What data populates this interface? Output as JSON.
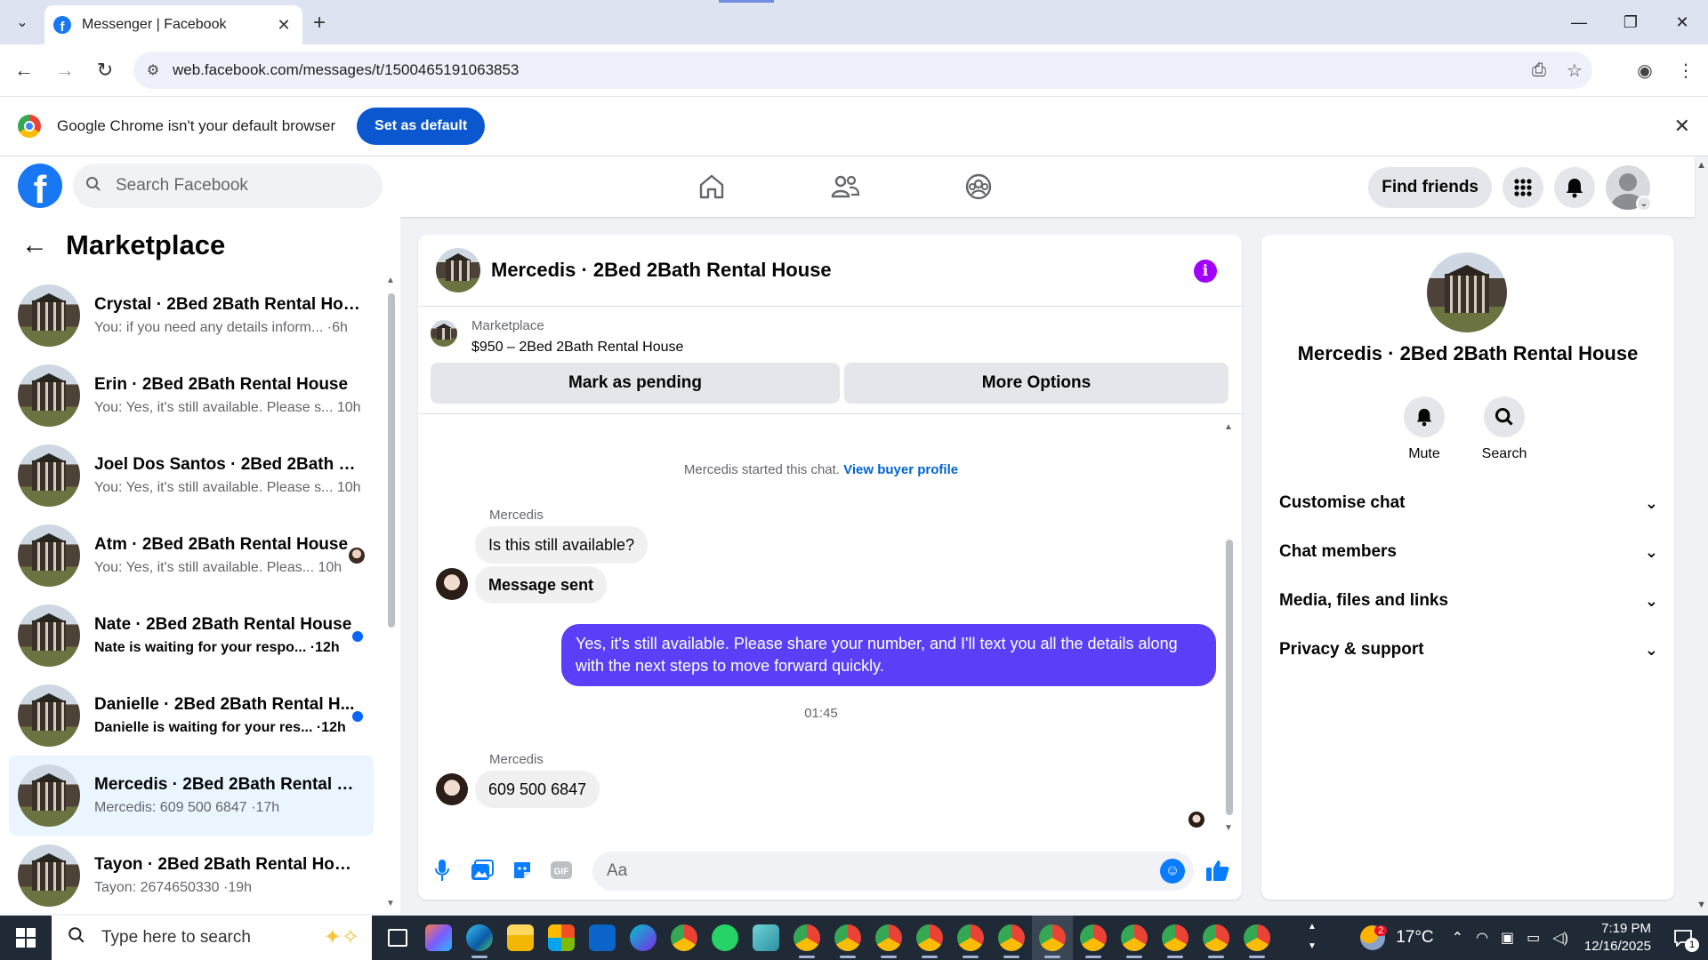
{
  "browser": {
    "tab_title": "Messenger | Facebook",
    "url": "web.facebook.com/messages/t/1500465191063853",
    "infobar_message": "Google Chrome isn't your default browser",
    "infobar_button": "Set as default"
  },
  "header": {
    "search_placeholder": "Search Facebook",
    "find_friends": "Find friends"
  },
  "left": {
    "title": "Marketplace",
    "conversations": [
      {
        "name": "Crystal · 2Bed 2Bath Rental House",
        "preview": "You: if you need any details inform... ·6h",
        "unread": false
      },
      {
        "name": "Erin · 2Bed 2Bath Rental House",
        "preview": "You: Yes, it's still available. Please s... 10h",
        "unread": false
      },
      {
        "name": "Joel Dos Santos · 2Bed 2Bath Re...",
        "preview": "You: Yes, it's still available. Please s... 10h",
        "unread": false
      },
      {
        "name": "Atm · 2Bed 2Bath Rental House",
        "preview": "You: Yes, it's still available. Pleas... 10h",
        "unread": false
      },
      {
        "name": "Nate · 2Bed 2Bath Rental House",
        "preview": "Nate is waiting for your respo... ·12h",
        "unread": true
      },
      {
        "name": "Danielle · 2Bed 2Bath Rental H...",
        "preview": "Danielle is waiting for your res... ·12h",
        "unread": true
      },
      {
        "name": "Mercedis · 2Bed 2Bath Rental H...",
        "preview": "Mercedis: 609 500 6847 ·17h",
        "unread": false
      },
      {
        "name": "Tayon · 2Bed 2Bath Rental House",
        "preview": "Tayon: 2674650330 ·19h",
        "unread": false
      }
    ]
  },
  "chat": {
    "title": "Mercedis · 2Bed 2Bath Rental House",
    "listing_label": "Marketplace",
    "listing_price": "$950 – 2Bed 2Bath Rental House",
    "mark_pending": "Mark as pending",
    "more_options": "More Options",
    "system_text": "Mercedis started this chat.",
    "system_link": "View buyer profile",
    "sender1": "Mercedis",
    "msg1": "Is this still available?",
    "msg2": "Message sent",
    "msg_out": "Yes, it's still available. Please share your number, and I'll text you all the details along with the next steps to move forward quickly.",
    "timestamp": "01:45",
    "sender2": "Mercedis",
    "msg3": "609 500 6847",
    "composer_placeholder": "Aa"
  },
  "right": {
    "name": "Mercedis · 2Bed 2Bath Rental House",
    "mute": "Mute",
    "search": "Search",
    "sections": [
      "Customise chat",
      "Chat members",
      "Media, files and links",
      "Privacy & support"
    ]
  },
  "taskbar": {
    "search_placeholder": "Type here to search",
    "temperature": "17°C",
    "time": "7:19 PM",
    "date": "12/16/2025",
    "notification_count": "1",
    "weather_badge": "2"
  },
  "colors": {
    "fb_blue": "#1877f2",
    "outgoing_bubble": "#5b3ff8",
    "info_purple": "#a100ff",
    "unread_dot": "#0866ff"
  }
}
